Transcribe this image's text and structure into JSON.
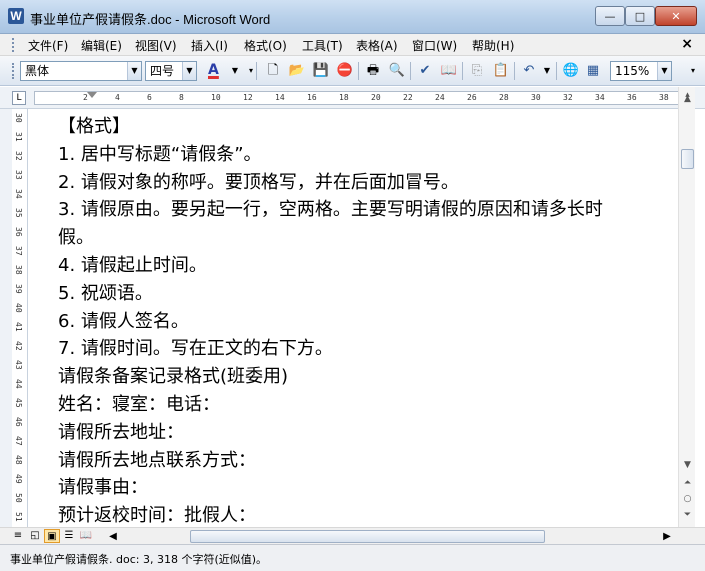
{
  "window": {
    "title": "事业单位产假请假条.doc - Microsoft Word",
    "app_icon": "W",
    "buttons": {
      "minimize": "—",
      "maximize": "□",
      "close": "✕"
    }
  },
  "menu": {
    "items": [
      "文件(F)",
      "编辑(E)",
      "视图(V)",
      "插入(I)",
      "格式(O)",
      "工具(T)",
      "表格(A)",
      "窗口(W)",
      "帮助(H)"
    ],
    "close": "×"
  },
  "toolbar": {
    "font_name": "黑体",
    "font_size": "四号",
    "font_color_label": "A",
    "zoom": "115%",
    "accent_color": "#2b3ea8",
    "font_color_bar": "#e03030"
  },
  "ruler": {
    "corner": "L",
    "marks": [
      "2",
      "4",
      "6",
      "8",
      "10",
      "12",
      "14",
      "16",
      "18",
      "20",
      "22",
      "24",
      "26",
      "28",
      "30",
      "32",
      "34",
      "36",
      "38"
    ]
  },
  "vruler": {
    "marks": [
      "30",
      "31",
      "32",
      "33",
      "34",
      "35",
      "36",
      "37",
      "38",
      "39",
      "40",
      "41",
      "42",
      "43",
      "44",
      "45",
      "46",
      "47",
      "48",
      "49",
      "50",
      "51"
    ]
  },
  "document": {
    "lines": [
      "【格式】",
      "1. 居中写标题“请假条”。",
      "2. 请假对象的称呼。要顶格写，并在后面加冒号。",
      "3. 请假原由。要另起一行，空两格。主要写明请假的原因和请多长时",
      "假。",
      "4. 请假起止时间。",
      "5. 祝颂语。",
      "6. 请假人签名。",
      "7. 请假时间。写在正文的右下方。",
      "请假条备案记录格式(班委用)",
      "姓名：寝室：电话：",
      "请假所去地址：",
      "请假所去地点联系方式：",
      "请假事由：",
      "预计返校时间：批假人："
    ]
  },
  "statusbar": {
    "text": "事业单位产假请假条. doc: 3, 318 个字符(近似值)。"
  }
}
